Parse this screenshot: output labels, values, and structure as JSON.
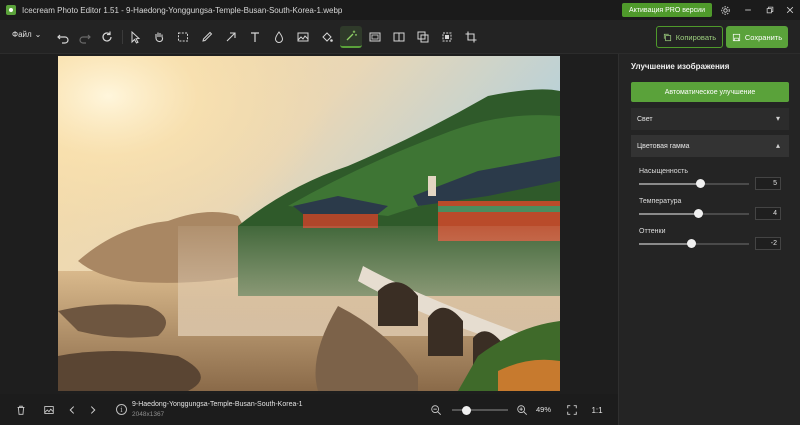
{
  "app": {
    "title": "Icecream Photo Editor 1.51 - 9-Haedong-Yonggungsa-Temple-Busan-South-Korea-1.webp",
    "pro_button": "Активация PRO версии"
  },
  "toolbar": {
    "file_menu": "Файл",
    "copy_label": "Копировать",
    "save_label": "Сохранить",
    "active_tool": "enhance",
    "tools": [
      "undo",
      "redo",
      "reset",
      "select",
      "hand",
      "crop-select",
      "brush",
      "arrow",
      "text",
      "drop",
      "image",
      "fill",
      "enhance",
      "frame",
      "compare",
      "layers",
      "transform",
      "crop"
    ]
  },
  "panel": {
    "title": "Улучшение изображения",
    "auto_button": "Автоматическое улучшение",
    "sections": [
      {
        "label": "Свет",
        "expanded": false
      },
      {
        "label": "Цветовая гамма",
        "expanded": true
      }
    ],
    "sliders": [
      {
        "label": "Насыщенность",
        "value": "5",
        "fraction": 0.55
      },
      {
        "label": "Температура",
        "value": "4",
        "fraction": 0.54
      },
      {
        "label": "Оттенки",
        "value": "-2",
        "fraction": 0.47
      }
    ]
  },
  "status": {
    "filename": "9-Haedong-Yonggungsa-Temple-Busan-South-Korea-1",
    "dimensions": "2048x1367",
    "zoom": "49%",
    "zoom_fraction": 0.25,
    "actual_size": "1:1"
  },
  "colors": {
    "accent": "#5aa23a",
    "background": "#1e1e1e",
    "panel": "#242424"
  }
}
